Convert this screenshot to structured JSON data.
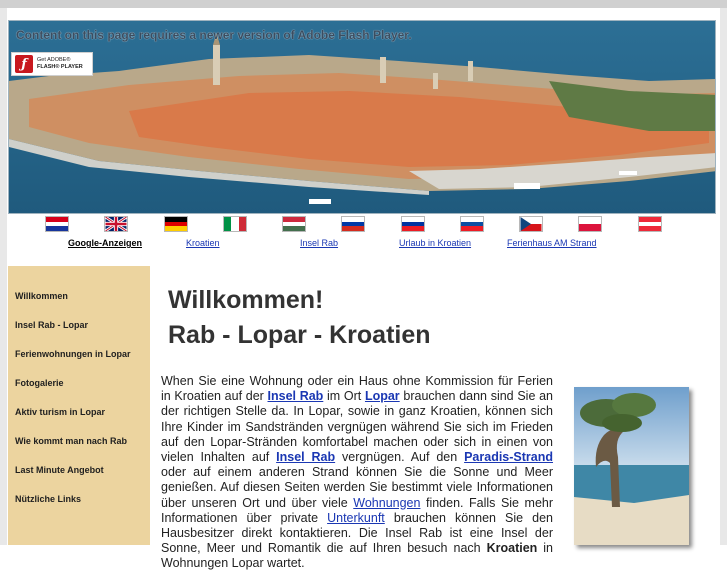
{
  "flash": {
    "message": "Content on this page requires a newer version of Adobe Flash Player.",
    "button_line1": "Get ADOBE®",
    "button_line2": "FLASH® PLAYER"
  },
  "flags": [
    {
      "name": "croatia",
      "colors": [
        "#d7001a",
        "#ffffff",
        "#17359c"
      ]
    },
    {
      "name": "uk"
    },
    {
      "name": "germany",
      "colors": [
        "#000000",
        "#dd0000",
        "#ffce00"
      ]
    },
    {
      "name": "italy",
      "colors": [
        "#009246",
        "#ffffff",
        "#ce2b37"
      ]
    },
    {
      "name": "hungary",
      "colors": [
        "#cd2a3e",
        "#ffffff",
        "#436f4d"
      ]
    },
    {
      "name": "russia",
      "colors": [
        "#ffffff",
        "#0039a6",
        "#d52b1e"
      ]
    },
    {
      "name": "slovenia",
      "colors": [
        "#ffffff",
        "#0033a0",
        "#ed1c24"
      ]
    },
    {
      "name": "slovakia",
      "colors": [
        "#ffffff",
        "#0b4ea2",
        "#ee1c25"
      ]
    },
    {
      "name": "czech"
    },
    {
      "name": "poland",
      "colors": [
        "#ffffff",
        "#dc143c"
      ]
    },
    {
      "name": "austria",
      "colors": [
        "#ed2939",
        "#ffffff",
        "#ed2939"
      ]
    }
  ],
  "ads": {
    "title": "Google-Anzeigen",
    "links": [
      "Kroatien",
      "Insel Rab",
      "Urlaub in Kroatien",
      "Ferienhaus AM Strand"
    ]
  },
  "nav": {
    "items": [
      "Willkommen",
      "Insel Rab - Lopar",
      "Ferienwohnungen in Lopar",
      "Fotogalerie",
      "Aktiv turism in Lopar",
      "Wie kommt man nach Rab",
      "Last Minute Angebot",
      "Nützliche Links"
    ]
  },
  "main": {
    "heading1": "Willkommen!",
    "heading2": "Rab - Lopar - Kroatien",
    "p": {
      "t1": "When Sie eine Wohnung oder ein Haus ohne Kommission für Ferien in Kroatien auf der ",
      "l1": "Insel Rab",
      "t2": " im Ort ",
      "l2": "Lopar",
      "t3": " brauchen dann sind Sie an der richtigen Stelle da. In Lopar, sowie in ganz Kroatien, können sich Ihre Kinder im Sandstränden vergnügen während Sie sich im Frieden auf den Lopar-Stränden komfortabel machen oder sich in einen von vielen Inhalten auf ",
      "l3": "Insel Rab",
      "t4": " vergnügen. Auf den ",
      "l4": "Paradis-Strand",
      "t5": " oder auf einem anderen Strand können Sie die Sonne und Meer genießen. Auf diesen Seiten werden Sie bestimmt viele Informationen über unseren Ort und über viele ",
      "l5": "Wohnungen",
      "t6": " finden. Falls Sie mehr Informationen über private ",
      "l6": "Unterkunft",
      "t7": " brauchen können Sie den Hausbesitzer direkt kontaktieren. Die Insel Rab ist eine Insel der Sonne, Meer und Romantik die auf Ihren besuch nach ",
      "b1": "Kroatien",
      "t8": " in Wohnungen Lopar wartet."
    }
  }
}
